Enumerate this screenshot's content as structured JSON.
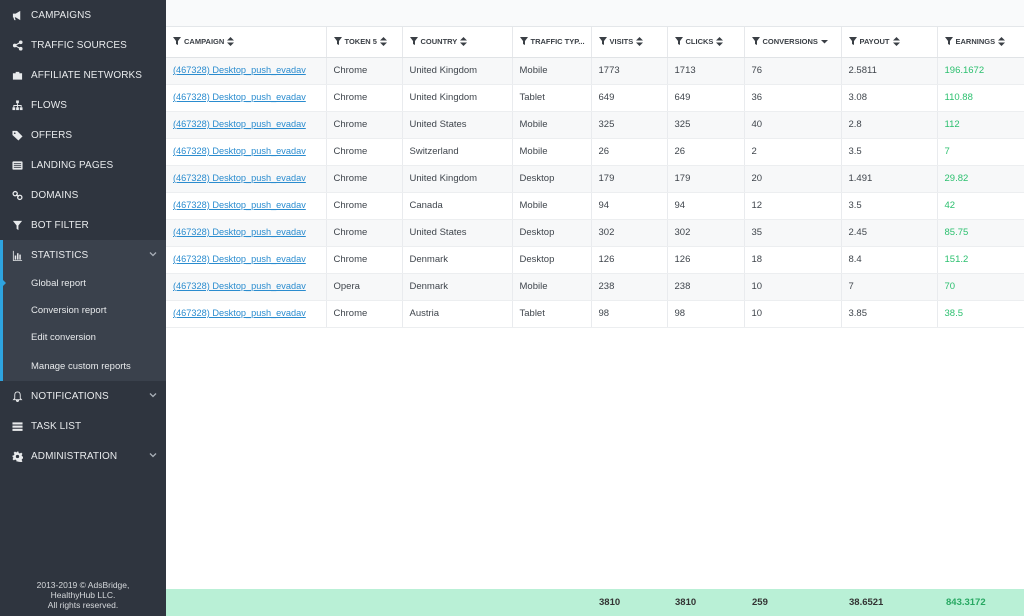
{
  "sidebar": {
    "items": [
      {
        "label": "CAMPAIGNS",
        "icon": "megaphone-icon"
      },
      {
        "label": "TRAFFIC SOURCES",
        "icon": "share-icon"
      },
      {
        "label": "AFFILIATE NETWORKS",
        "icon": "briefcase-icon"
      },
      {
        "label": "FLOWS",
        "icon": "sitemap-icon"
      },
      {
        "label": "OFFERS",
        "icon": "tags-icon"
      },
      {
        "label": "LANDING PAGES",
        "icon": "list-icon"
      },
      {
        "label": "DOMAINS",
        "icon": "link-icon"
      },
      {
        "label": "BOT FILTER",
        "icon": "filter-icon"
      }
    ],
    "statistics": {
      "label": "STATISTICS",
      "icon": "bar-chart-icon",
      "sub": [
        "Global report",
        "Conversion report",
        "Edit conversion",
        "Manage custom reports"
      ]
    },
    "bottom_items": [
      {
        "label": "NOTIFICATIONS",
        "icon": "bell-icon"
      },
      {
        "label": "TASK LIST",
        "icon": "tasks-icon"
      },
      {
        "label": "ADMINISTRATION",
        "icon": "gear-icon"
      }
    ],
    "footer": [
      "2013-2019 © AdsBridge,",
      "HealthyHub LLC.",
      "All rights reserved."
    ]
  },
  "table": {
    "columns": [
      "CAMPAIGN",
      "TOKEN 5",
      "COUNTRY",
      "TRAFFIC TYP...",
      "VISITS",
      "CLICKS",
      "CONVERSIONS",
      "PAYOUT",
      "EARNINGS"
    ],
    "rows": [
      [
        "(467328) Desktop_push_evadav",
        "Chrome",
        "United Kingdom",
        "Mobile",
        "1773",
        "1713",
        "76",
        "2.5811",
        "196.1672"
      ],
      [
        "(467328) Desktop_push_evadav",
        "Chrome",
        "United Kingdom",
        "Tablet",
        "649",
        "649",
        "36",
        "3.08",
        "110.88"
      ],
      [
        "(467328) Desktop_push_evadav",
        "Chrome",
        "United States",
        "Mobile",
        "325",
        "325",
        "40",
        "2.8",
        "112"
      ],
      [
        "(467328) Desktop_push_evadav",
        "Chrome",
        "Switzerland",
        "Mobile",
        "26",
        "26",
        "2",
        "3.5",
        "7"
      ],
      [
        "(467328) Desktop_push_evadav",
        "Chrome",
        "United Kingdom",
        "Desktop",
        "179",
        "179",
        "20",
        "1.491",
        "29.82"
      ],
      [
        "(467328) Desktop_push_evadav",
        "Chrome",
        "Canada",
        "Mobile",
        "94",
        "94",
        "12",
        "3.5",
        "42"
      ],
      [
        "(467328) Desktop_push_evadav",
        "Chrome",
        "United States",
        "Desktop",
        "302",
        "302",
        "35",
        "2.45",
        "85.75"
      ],
      [
        "(467328) Desktop_push_evadav",
        "Chrome",
        "Denmark",
        "Desktop",
        "126",
        "126",
        "18",
        "8.4",
        "151.2"
      ],
      [
        "(467328) Desktop_push_evadav",
        "Opera",
        "Denmark",
        "Mobile",
        "238",
        "238",
        "10",
        "7",
        "70"
      ],
      [
        "(467328) Desktop_push_evadav",
        "Chrome",
        "Austria",
        "Tablet",
        "98",
        "98",
        "10",
        "3.85",
        "38.5"
      ]
    ],
    "totals": {
      "visits": "3810",
      "clicks": "3810",
      "conversions": "259",
      "payout": "38.6521",
      "earnings": "843.3172"
    }
  },
  "colors": {
    "sidebar_bg": "#2f353f",
    "accent": "#2ea4e0",
    "link": "#2a8ccf",
    "earnings": "#2cc06f",
    "totals_bg": "#b9f0d6"
  }
}
